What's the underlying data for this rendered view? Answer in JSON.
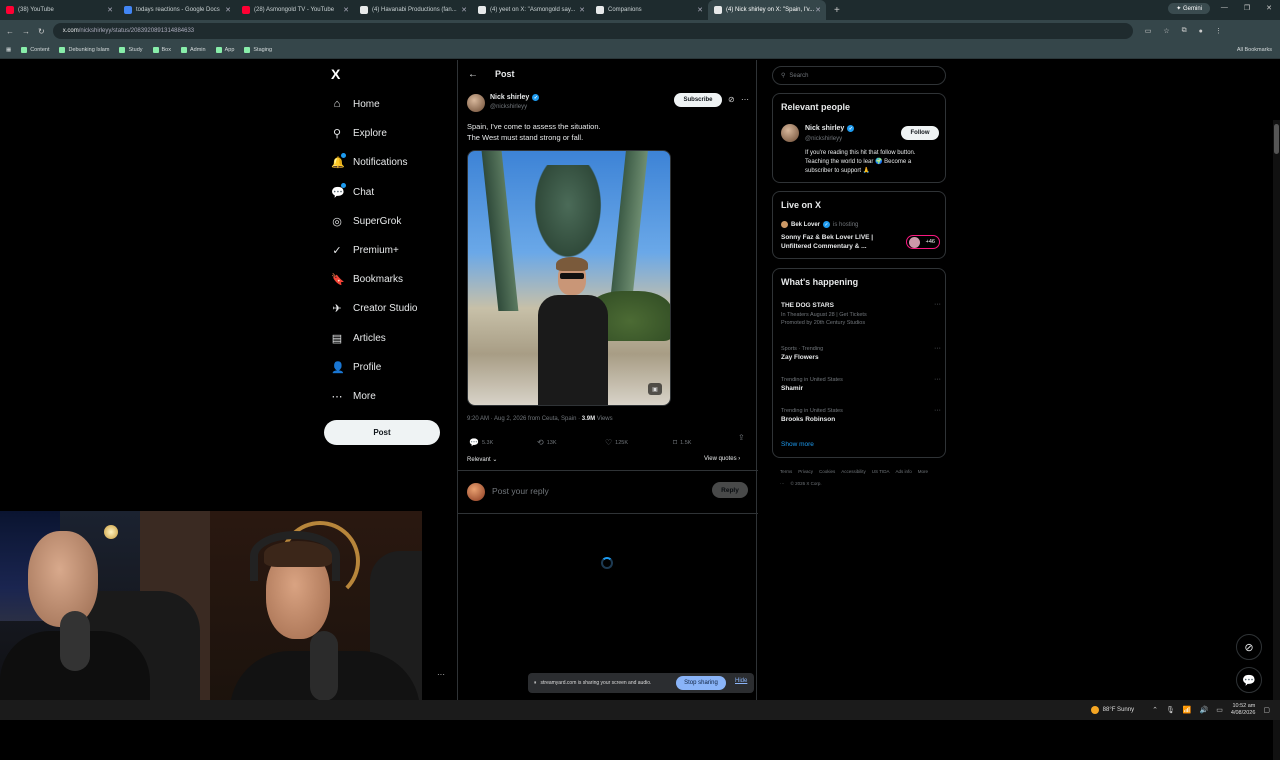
{
  "browser": {
    "tabs": [
      {
        "label": "(38) YouTube",
        "color": "#ff0033"
      },
      {
        "label": "todays reactions - Google Docs",
        "color": "#4285f4"
      },
      {
        "label": "(28) Asmongold TV - YouTube",
        "color": "#ff0033"
      },
      {
        "label": "(4) Havanabi Productions (fan...",
        "color": "#e7e9ea"
      },
      {
        "label": "(4) yeet on X: \"Asmongold say...",
        "color": "#e7e9ea"
      },
      {
        "label": "Companions",
        "color": "#e7e9ea"
      },
      {
        "label": "(4) Nick shirley on X: \"Spain, I'v...",
        "color": "#e7e9ea"
      }
    ],
    "gemini_label": "Gemini",
    "url_domain": "x.com",
    "url_path": "/nickshirleyy/status/2083920891314884633",
    "bookmarks": [
      "Content",
      "Debunking Islam",
      "Study",
      "Box",
      "Admin",
      "App",
      "Staging"
    ],
    "all_bookmarks": "All Bookmarks"
  },
  "x": {
    "logo": "X",
    "nav": [
      {
        "label": "Home",
        "icon": "home-icon",
        "glyph": "⌂"
      },
      {
        "label": "Explore",
        "icon": "search-icon",
        "glyph": "⚲"
      },
      {
        "label": "Notifications",
        "icon": "bell-icon",
        "glyph": "🔔"
      },
      {
        "label": "Chat",
        "icon": "chat-icon",
        "glyph": "💬"
      },
      {
        "label": "SuperGrok",
        "icon": "grok-icon",
        "glyph": "◎"
      },
      {
        "label": "Premium+",
        "icon": "premium-icon",
        "glyph": "✓"
      },
      {
        "label": "Bookmarks",
        "icon": "bookmark-icon",
        "glyph": "🔖"
      },
      {
        "label": "Creator Studio",
        "icon": "rocket-icon",
        "glyph": "✈"
      },
      {
        "label": "Articles",
        "icon": "article-icon",
        "glyph": "▤"
      },
      {
        "label": "Profile",
        "icon": "profile-icon",
        "glyph": "👤"
      },
      {
        "label": "More",
        "icon": "more-icon",
        "glyph": "⋯"
      }
    ],
    "post_button": "Post",
    "main_title": "Post",
    "post": {
      "author": "Nick shirley",
      "handle": "@nickshirleyy",
      "subscribe": "Subscribe",
      "text_line1": "Spain, I've come to assess the situation.",
      "text_line2": "The West must stand strong or fall.",
      "meta": "9:20 AM · Aug 2, 2026 from Ceuta, Spain · ",
      "views_count": "3.9M",
      "views_label": " Views",
      "replies": "5.3K",
      "reposts": "13K",
      "likes": "125K",
      "bookmarks": "1.5K",
      "sort": "Relevant ⌄",
      "view_quotes": "View quotes ›",
      "reply_placeholder": "Post your reply",
      "reply_button": "Reply"
    },
    "right": {
      "search_placeholder": "Search",
      "relevant_title": "Relevant people",
      "rel_name": "Nick shirley",
      "rel_handle": "@nickshirleyy",
      "follow": "Follow",
      "rel_bio": "If you're reading this hit that follow button. Teaching the world to lear 🌍 Become a subscriber to support 🙏",
      "live_title": "Live on X",
      "live_host": "Bek Lover",
      "live_hosting": "is hosting",
      "live_stream": "Sonny Faz & Bek Lover LIVE | Unfiltered Commentary & ...",
      "live_count": "+46",
      "happening_title": "What's happening",
      "trends": [
        {
          "sub": "",
          "name": "THE DOG STARS",
          "sub2": "In Theaters August 28 | Get Tickets",
          "sub3": "Promoted by 20th Century Studios"
        },
        {
          "sub": "Sports · Trending",
          "name": "Zay Flowers"
        },
        {
          "sub": "Trending in United States",
          "name": "Shamir"
        },
        {
          "sub": "Trending in United States",
          "name": "Brooks Robinson"
        }
      ],
      "show_more": "Show more",
      "footer": [
        "Terms",
        "Privacy",
        "Cookies",
        "Accessibility",
        "US TIDA",
        "Ads info",
        "More ···",
        "© 2026 X Corp."
      ]
    }
  },
  "share": {
    "message": "streamyard.com is sharing your screen and audio.",
    "stop": "Stop sharing",
    "hide": "Hide"
  },
  "taskbar": {
    "weather": "88°F  Sunny",
    "time": "10:52 am",
    "date": "4/08/2026"
  }
}
